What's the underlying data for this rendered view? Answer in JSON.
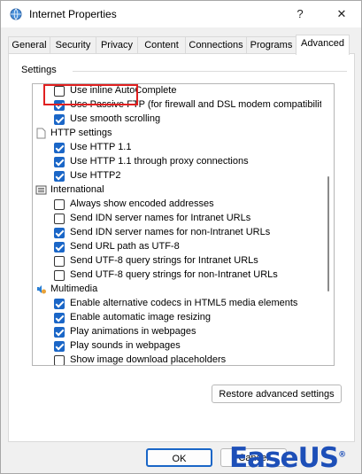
{
  "window": {
    "title": "Internet Properties",
    "help_glyph": "?",
    "close_glyph": "✕",
    "icon": "globe-icon"
  },
  "tabs": [
    {
      "label": "General"
    },
    {
      "label": "Security"
    },
    {
      "label": "Privacy"
    },
    {
      "label": "Content"
    },
    {
      "label": "Connections"
    },
    {
      "label": "Programs"
    },
    {
      "label": "Advanced",
      "active": true
    }
  ],
  "settings": {
    "group_label": "Settings",
    "rows": [
      {
        "label": "Use inline AutoComplete",
        "checked": false
      },
      {
        "label": "Use Passive FTP (for firewall and DSL modem compatibility",
        "checked": true
      },
      {
        "label": "Use smooth scrolling",
        "checked": true
      },
      {
        "label": "HTTP settings",
        "category": true,
        "icon": "page-icon"
      },
      {
        "label": "Use HTTP 1.1",
        "checked": true
      },
      {
        "label": "Use HTTP 1.1 through proxy connections",
        "checked": true
      },
      {
        "label": "Use HTTP2",
        "checked": true
      },
      {
        "label": "International",
        "category": true,
        "icon": "list-icon"
      },
      {
        "label": "Always show encoded addresses",
        "checked": false
      },
      {
        "label": "Send IDN server names for Intranet URLs",
        "checked": false
      },
      {
        "label": "Send IDN server names for non-Intranet URLs",
        "checked": true
      },
      {
        "label": "Send URL path as UTF-8",
        "checked": true
      },
      {
        "label": "Send UTF-8 query strings for Intranet URLs",
        "checked": false
      },
      {
        "label": "Send UTF-8 query strings for non-Intranet URLs",
        "checked": false
      },
      {
        "label": "Multimedia",
        "category": true,
        "icon": "multimedia-icon"
      },
      {
        "label": "Enable alternative codecs in HTML5 media elements",
        "checked": true
      },
      {
        "label": "Enable automatic image resizing",
        "checked": true
      },
      {
        "label": "Play animations in webpages",
        "checked": true
      },
      {
        "label": "Play sounds in webpages",
        "checked": true
      },
      {
        "label": "Show image download placeholders",
        "checked": false
      }
    ]
  },
  "buttons": {
    "restore": "Restore advanced settings",
    "ok": "OK",
    "cancel": "Cancel"
  },
  "watermark": {
    "text": "EaseUS",
    "reg": "®"
  },
  "colors": {
    "accent": "#1a66c7",
    "highlight": "#e02020",
    "watermark": "#1d4fb8"
  }
}
